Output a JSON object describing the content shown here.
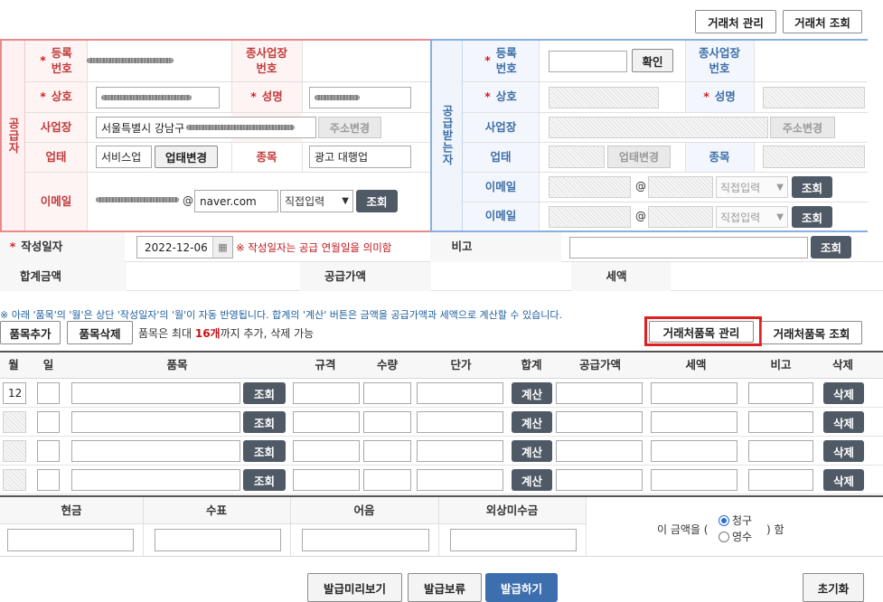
{
  "top_buttons": {
    "partner_manage": "거래처 관리",
    "partner_lookup": "거래처 조회"
  },
  "supplier": {
    "side_label": "공급자",
    "reg_no_label": "등록\n번호",
    "sub_biz_label": "종사업장\n번호",
    "company_label": "상호",
    "name_label": "성명",
    "address_label": "사업장",
    "address_value": "서울특별시 강남구",
    "address_change": "주소변경",
    "biz_type_label": "업태",
    "biz_type_value": "서비스업",
    "biz_type_change": "업태변경",
    "item_label": "종목",
    "item_value": "광고 대행업",
    "email_label": "이메일",
    "email_at": "@",
    "email_domain": "naver.com",
    "email_select": "직접입력",
    "lookup": "조회"
  },
  "receiver": {
    "side_label": "공급받는자",
    "reg_no_label": "등록\n번호",
    "confirm": "확인",
    "sub_biz_label": "종사업장\n번호",
    "company_label": "상호",
    "name_label": "성명",
    "address_label": "사업장",
    "address_change": "주소변경",
    "biz_type_label": "업태",
    "biz_type_change": "업태변경",
    "item_label": "종목",
    "email_label": "이메일",
    "email_at": "@",
    "email_select": "직접입력",
    "lookup": "조회"
  },
  "required_mark": "*",
  "date_row": {
    "label": "작성일자",
    "value": "2022-12-06",
    "note": "※ 작성일자는 공급 연월일을 의미함",
    "remark_label": "비고",
    "lookup": "조회"
  },
  "totals_row": {
    "total": "합계금액",
    "supply": "공급가액",
    "tax": "세액"
  },
  "notice": "※ 아래 '품목'의 '월'은 상단 '작성일자'의 '월'이 자동 반영됩니다. 합계의 '계산' 버튼은 금액을 공급가액과 세액으로 계산할 수 있습니다.",
  "item_controls": {
    "add": "품목추가",
    "delete": "품목삭제",
    "limit_pre": "품목은 최대 ",
    "limit_num": "16개",
    "limit_post": "까지 추가, 삭제 가능",
    "partner_items_manage": "거래처품목 관리",
    "partner_items_lookup": "거래처품목 조회"
  },
  "table_headers": [
    "월",
    "일",
    "품목",
    "규격",
    "수량",
    "단가",
    "합계",
    "공급가액",
    "세액",
    "비고",
    "삭제"
  ],
  "rows": [
    {
      "month": "12"
    },
    {
      "month": ""
    },
    {
      "month": ""
    },
    {
      "month": ""
    }
  ],
  "row_buttons": {
    "lookup": "조회",
    "calc": "계산",
    "delete": "삭제"
  },
  "payment_headers": [
    "현금",
    "수표",
    "어음",
    "외상미수금"
  ],
  "amount_text": {
    "pre": "이 금액을 (",
    "claim": "청구",
    "receipt": "영수",
    "post": ") 함",
    "selected": "청구"
  },
  "bottom_buttons": {
    "preview": "발급미리보기",
    "hold": "발급보류",
    "issue": "발급하기",
    "reset": "초기화"
  },
  "colors": {
    "supplier": "#e88a8a",
    "receiver": "#8aaee0",
    "dark_button": "#505a66",
    "issue_button": "#3d6faf",
    "highlight": "#e02020"
  }
}
